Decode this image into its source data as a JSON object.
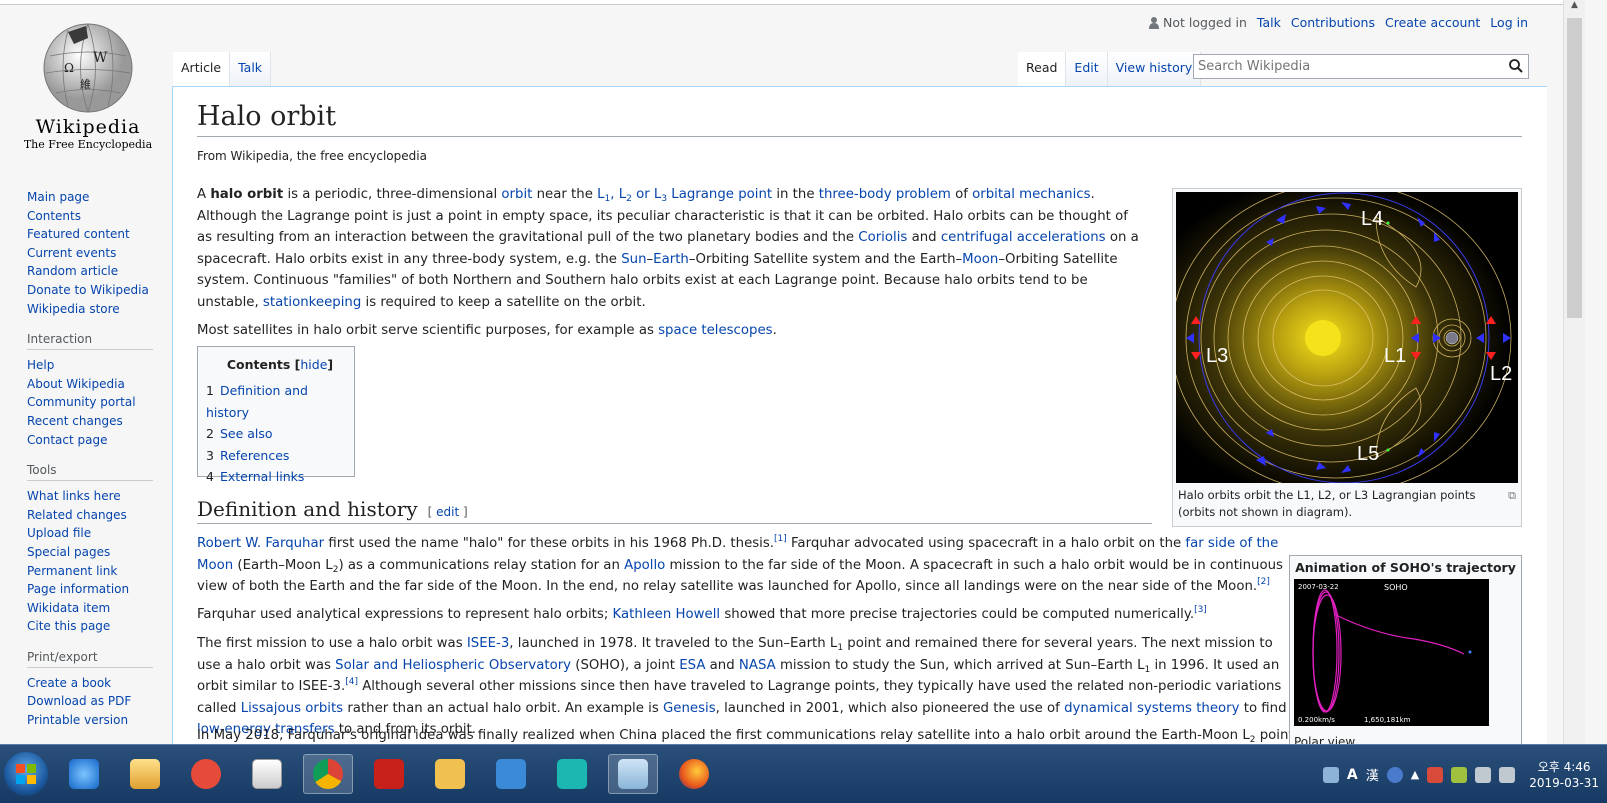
{
  "logo": {
    "wordmark": "Wikipedia",
    "tagline": "The Free Encyclopedia",
    "icon": "wikipedia-globe-logo"
  },
  "sidebar": {
    "main": [
      "Main page",
      "Contents",
      "Featured content",
      "Current events",
      "Random article",
      "Donate to Wikipedia",
      "Wikipedia store"
    ],
    "interaction": {
      "heading": "Interaction",
      "items": [
        "Help",
        "About Wikipedia",
        "Community portal",
        "Recent changes",
        "Contact page"
      ]
    },
    "tools": {
      "heading": "Tools",
      "items": [
        "What links here",
        "Related changes",
        "Upload file",
        "Special pages",
        "Permanent link",
        "Page information",
        "Wikidata item",
        "Cite this page"
      ]
    },
    "print": {
      "heading": "Print/export",
      "items": [
        "Create a book",
        "Download as PDF",
        "Printable version"
      ]
    }
  },
  "usernav": {
    "not_logged": "Not logged in",
    "talk": "Talk",
    "contributions": "Contributions",
    "create": "Create account",
    "login": "Log in"
  },
  "tabs": {
    "article": "Article",
    "talk": "Talk",
    "read": "Read",
    "edit": "Edit",
    "history": "View history"
  },
  "search": {
    "placeholder": "Search Wikipedia"
  },
  "page": {
    "title": "Halo orbit",
    "from": "From Wikipedia, the free encyclopedia"
  },
  "toc": {
    "title": "Contents",
    "hide": "hide",
    "items": [
      {
        "n": "1",
        "label": "Definition and history"
      },
      {
        "n": "2",
        "label": "See also"
      },
      {
        "n": "3",
        "label": "References"
      },
      {
        "n": "4",
        "label": "External links"
      }
    ]
  },
  "section": {
    "heading": "Definition and history",
    "edit": "edit"
  },
  "figure": {
    "labels": [
      "L4",
      "L3",
      "L1",
      "L2",
      "L5"
    ],
    "caption": "Halo orbits orbit the L1, L2, or L3 Lagrangian points (orbits not shown in diagram)."
  },
  "infobox": {
    "title": "Animation of SOHO's trajectory",
    "date": "2007-03-22",
    "name": "SOHO",
    "speed": "0.200km/s",
    "distance": "1,650,181km",
    "caption": "Polar view",
    "orbit_color": "#e020c0"
  },
  "taskbar": {
    "clock_time": "오후 4:46",
    "clock_date": "2019-03-31",
    "ime1": "A",
    "ime2": "漢"
  },
  "colors": {
    "link": "#0645ad",
    "sun": "#f6e21a",
    "orbit_contours": "#e8c870",
    "arrows": "#3030ff",
    "markers": "#ff2020"
  }
}
